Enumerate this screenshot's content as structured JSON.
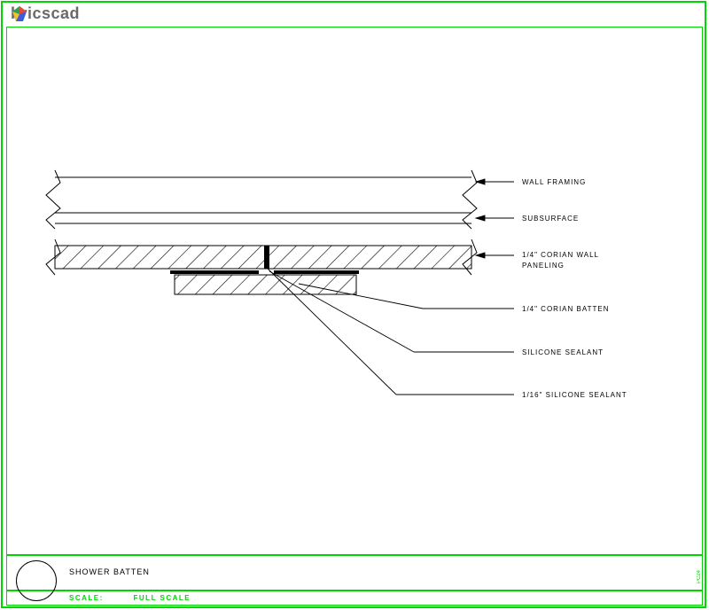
{
  "app": {
    "name": "bricscad"
  },
  "title": {
    "drawing_name": "SHOWER BATTEN",
    "scale_label": "SCALE:",
    "scale_value": "FULL SCALE",
    "side_code": "PC24"
  },
  "labels": {
    "wall_framing": "WALL FRAMING",
    "subsurface": "SUBSURFACE",
    "corian_wall_panel_l1": "1/4\" CORIAN WALL",
    "corian_wall_panel_l2": "PANELING",
    "corian_batten": "1/4\" CORIAN BATTEN",
    "silicone_sealant": "SILICONE SEALANT",
    "silicone_sealant_16": "1/16\" SILICONE SEALANT"
  }
}
